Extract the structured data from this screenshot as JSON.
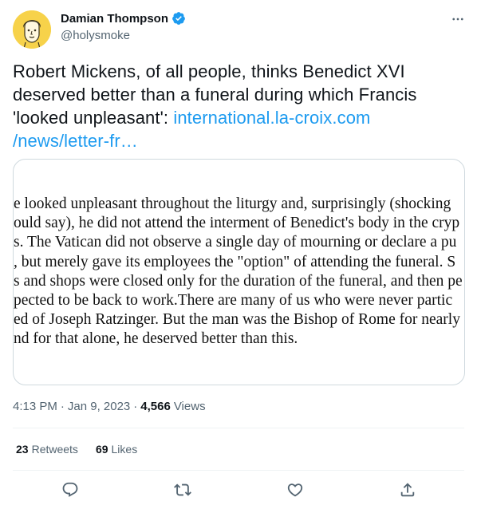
{
  "author": {
    "display_name": "Damian Thompson",
    "handle": "@holysmoke",
    "verified": true,
    "avatar_icon": "cartoon-portrait-avatar",
    "avatar_color": "#f7d24a"
  },
  "tweet": {
    "text": "Robert Mickens, of all people, thinks Benedict XVI deserved better than a funeral during which Francis 'looked unpleasant': ",
    "link_text": "international.la-croix.com/news/letter-fr…",
    "link_line1": "international.la-croix.com",
    "link_line2": "/news/letter-fr…",
    "link_color": "#1d9bf0"
  },
  "media": {
    "lines": [
      "e looked unpleasant throughout the liturgy and, surprisingly (shocking",
      "ould say), he did not attend the interment of Benedict's body in the cryp",
      "s. The Vatican did not observe a single day of mourning or declare a pu",
      ", but merely gave its employees the \"option\" of attending the funeral. S",
      "s and shops were closed only for the duration of the funeral, and then pe",
      "pected to be back to work.There are many of us who were never partic",
      "ed of Joseph Ratzinger. But the man was the Bishop of Rome for nearly",
      "nd for that alone, he deserved better than this."
    ]
  },
  "meta": {
    "time": "4:13 PM",
    "sep1": "·",
    "date": "Jan 9, 2023",
    "sep2": "·",
    "views_count": "4,566",
    "views_label": "Views"
  },
  "stats": {
    "retweets_count": "23",
    "retweets_label": "Retweets",
    "likes_count": "69",
    "likes_label": "Likes"
  },
  "actions": {
    "reply_icon": "reply-icon",
    "retweet_icon": "retweet-icon",
    "like_icon": "heart-icon",
    "share_icon": "share-icon"
  },
  "colors": {
    "text": "#0f1419",
    "secondary": "#536471",
    "border": "#cfd9de",
    "accent": "#1d9bf0"
  }
}
